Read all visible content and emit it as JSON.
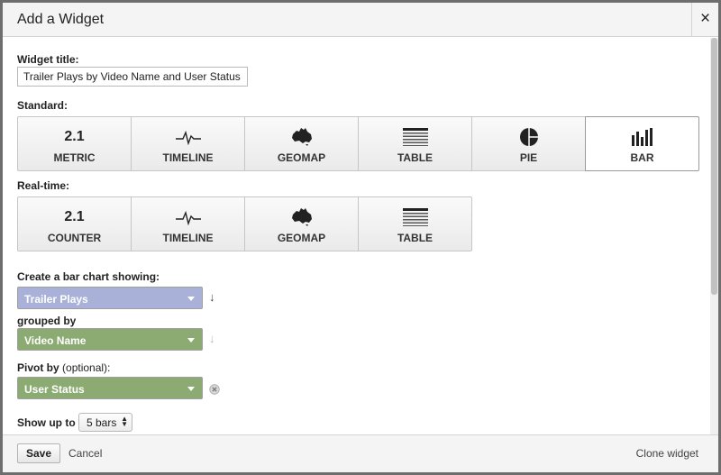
{
  "dialog": {
    "title": "Add a Widget",
    "close_glyph": "×"
  },
  "widget_title": {
    "label": "Widget title:",
    "value": "Trailer Plays by Video Name and User Status"
  },
  "standard": {
    "label": "Standard:",
    "tiles": [
      {
        "label": "METRIC",
        "icon": "metric-icon",
        "number": "2.1"
      },
      {
        "label": "TIMELINE",
        "icon": "timeline-icon"
      },
      {
        "label": "GEOMAP",
        "icon": "geomap-icon"
      },
      {
        "label": "TABLE",
        "icon": "table-icon"
      },
      {
        "label": "PIE",
        "icon": "pie-icon"
      },
      {
        "label": "BAR",
        "icon": "bar-chart-icon",
        "selected": true
      }
    ]
  },
  "realtime": {
    "label": "Real-time:",
    "tiles": [
      {
        "label": "COUNTER",
        "icon": "counter-icon",
        "number": "2.1"
      },
      {
        "label": "TIMELINE",
        "icon": "timeline-icon"
      },
      {
        "label": "GEOMAP",
        "icon": "geomap-icon"
      },
      {
        "label": "TABLE",
        "icon": "table-icon"
      }
    ]
  },
  "bar_config": {
    "showing_label": "Create a bar chart showing:",
    "metric": "Trailer Plays",
    "grouped_label": "grouped by",
    "dimension": "Video Name",
    "pivot_label_bold": "Pivot by",
    "pivot_label_normal": " (optional):",
    "pivot": "User Status",
    "show_up_to_label": "Show up to",
    "bars_value": "5 bars",
    "metric_color": "#a9b1d9",
    "dimension_color": "#8bab73"
  },
  "footer": {
    "save_label": "Save",
    "cancel_label": "Cancel",
    "clone_label": "Clone widget"
  }
}
